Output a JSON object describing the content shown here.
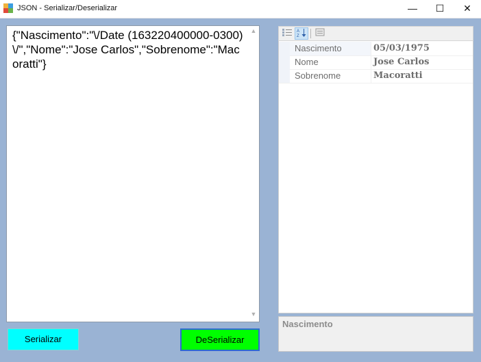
{
  "window": {
    "title": "JSON - Serializar/Deserializar",
    "controls": {
      "minimize": "—",
      "maximize": "☐",
      "close": "✕"
    }
  },
  "json_textbox": {
    "value": "{\"Nascimento\":\"\\/Date (163220400000-0300)\\/\",\"Nome\":\"Jose Carlos\",\"Sobrenome\":\"Macoratti\"}"
  },
  "buttons": {
    "serializar": "Serializar",
    "deserializar": "DeSerializar"
  },
  "property_grid": {
    "rows": [
      {
        "name": "Nascimento",
        "value": "05/03/1975"
      },
      {
        "name": "Nome",
        "value": "Jose Carlos"
      },
      {
        "name": "Sobrenome",
        "value": "Macoratti"
      }
    ],
    "help_title": "Nascimento"
  },
  "colors": {
    "client_bg": "#9ab3d4",
    "serializar_bg": "#00ffff",
    "deserializar_bg": "#00ff00"
  }
}
